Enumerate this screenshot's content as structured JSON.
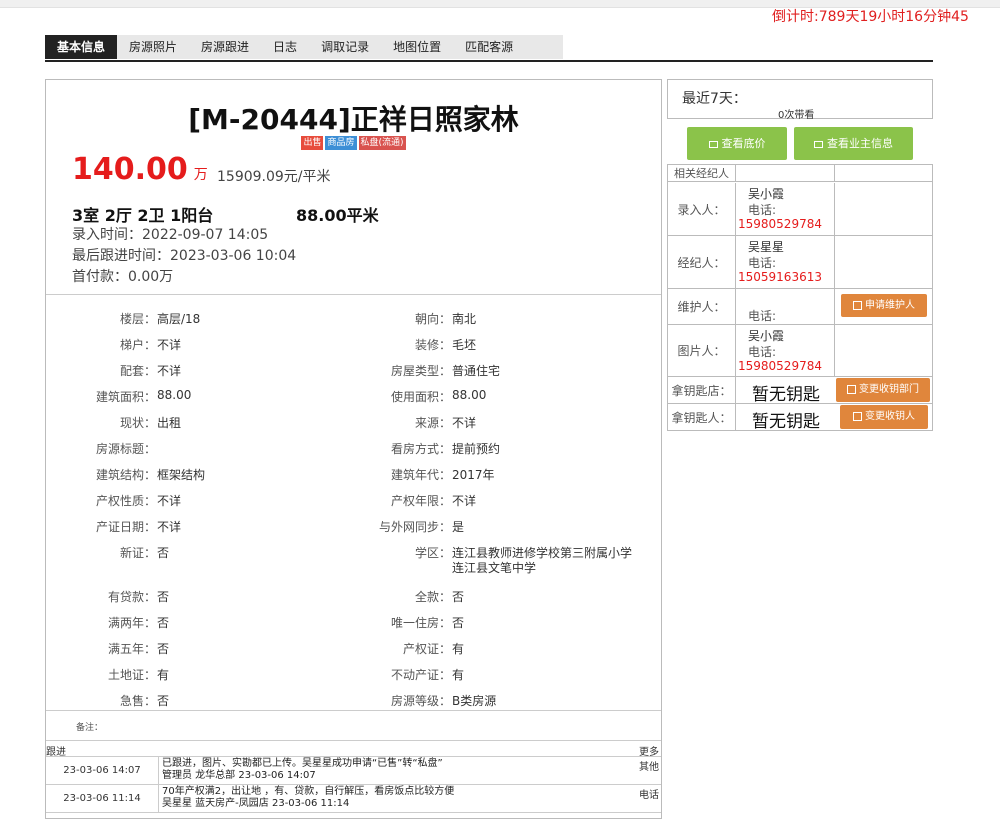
{
  "countdown": "倒计时:789天19小时16分钟45",
  "tabs": [
    "基本信息",
    "房源照片",
    "房源跟进",
    "日志",
    "调取记录",
    "地图位置",
    "匹配客源"
  ],
  "listing": {
    "title": "[M-20444]正祥日照家林",
    "tags": [
      "出售",
      "商品房",
      "私盘(流通)"
    ],
    "price": "140.00",
    "price_unit": "万",
    "unit_price": "15909.09元/平米",
    "rooms": "3室 2厅 2卫 1阳台",
    "area": "88.00平米",
    "entry_time": "录入时间：2022-09-07 14:05",
    "last_follow": "最后跟进时间：2023-03-06 10:04",
    "down_payment": "首付款：0.00万"
  },
  "fields": [
    [
      "楼层：",
      "高层/18",
      "朝向：",
      "南北"
    ],
    [
      "梯户：",
      "不详",
      "装修：",
      "毛坯"
    ],
    [
      "配套：",
      "不详",
      "房屋类型：",
      "普通住宅"
    ],
    [
      "建筑面积：",
      "88.00",
      "使用面积：",
      "88.00"
    ],
    [
      "现状：",
      "出租",
      "来源：",
      "不详"
    ],
    [
      "房源标题：",
      "",
      "看房方式：",
      "提前预约"
    ],
    [
      "建筑结构：",
      "框架结构",
      "建筑年代：",
      "2017年"
    ],
    [
      "产权性质：",
      "不详",
      "产权年限：",
      "不详"
    ],
    [
      "产证日期：",
      "不详",
      "与外网同步：",
      "是"
    ],
    [
      "新证：",
      "否",
      "学区：",
      "连江县教师进修学校第三附属小学"
    ],
    [
      "有贷款：",
      "否",
      "全款：",
      "否"
    ],
    [
      "满两年：",
      "否",
      "唯一住房：",
      "否"
    ],
    [
      "满五年：",
      "否",
      "产权证：",
      "有"
    ],
    [
      "土地证：",
      "有",
      "不动产证：",
      "有"
    ],
    [
      "急售：",
      "否",
      "房源等级：",
      "B类房源"
    ]
  ],
  "school_line2": "连江县文笔中学",
  "remark_label": "备注：",
  "follow": {
    "header": "跟进",
    "more": "更多",
    "rows": [
      {
        "date": "23-03-06 14:07",
        "line1": "已跟进，图片、实勘都已上传。吴星星成功申请“已售”转“私盘”",
        "line2": "管理员    龙华总部    23-03-06 14:07",
        "type": "其他"
      },
      {
        "date": "23-03-06 11:14",
        "line1": "70年产权满2，出让地 ，有、贷款，自行解压，看房饭点比较方便",
        "line2": "吴星星    蓝天房产-凤园店    23-03-06 11:14",
        "type": "电话"
      }
    ]
  },
  "recent": {
    "label": "最近7天：",
    "count": "0次带看"
  },
  "buttons": {
    "base_price": "查看底价",
    "owner_info": "查看业主信息"
  },
  "agents": {
    "header": "相关经纪人",
    "rows": [
      {
        "label": "录入人：",
        "name": "吴小霞",
        "tel_label": "电话:",
        "phone": "15980529784"
      },
      {
        "label": "经纪人：",
        "name": "吴星星",
        "tel_label": "电话:",
        "phone": "15059163613"
      },
      {
        "label": "维护人：",
        "name": "",
        "tel_label": "电话:",
        "phone": "",
        "button": "申请维护人"
      },
      {
        "label": "图片人：",
        "name": "吴小霞",
        "tel_label": "电话:",
        "phone": "15980529784"
      }
    ],
    "key_store": {
      "label": "拿钥匙店：",
      "value": "暂无钥匙",
      "button": "变更收钥部门"
    },
    "key_person": {
      "label": "拿钥匙人：",
      "value": "暂无钥匙",
      "button": "变更收钥人"
    }
  },
  "colors": {
    "price": "#e51c1c",
    "green_btn": "#8bc34a",
    "orange_btn": "#e0863c",
    "tab_active": "#222222"
  }
}
